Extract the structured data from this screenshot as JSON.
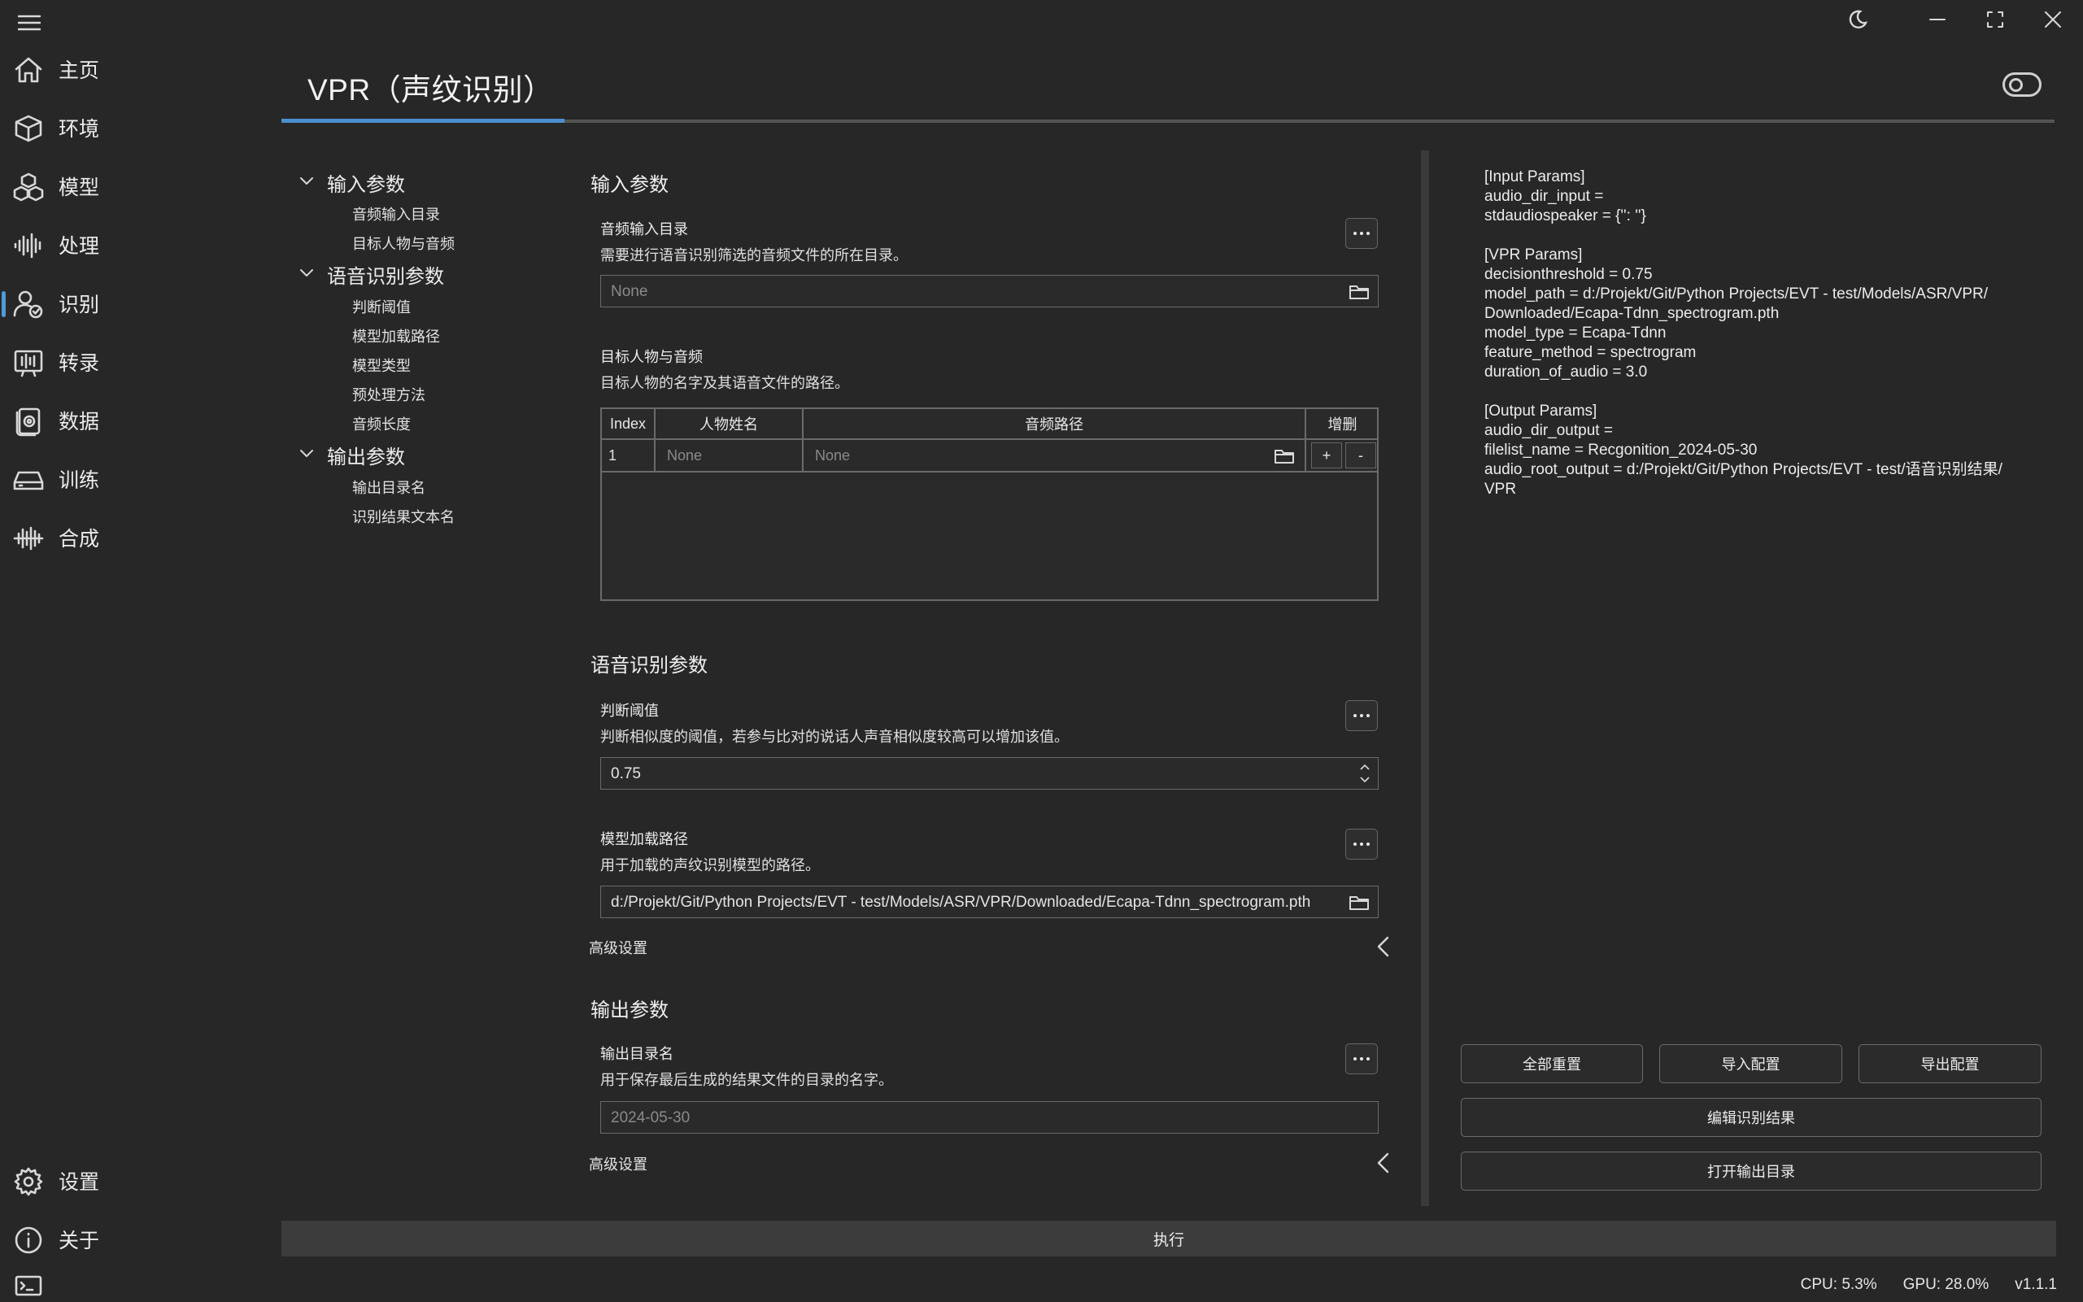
{
  "nav": {
    "items": [
      {
        "label": "主页",
        "icon": "home-icon"
      },
      {
        "label": "环境",
        "icon": "cube-icon"
      },
      {
        "label": "模型",
        "icon": "cubes-icon"
      },
      {
        "label": "处理",
        "icon": "waveform-icon"
      },
      {
        "label": "识别",
        "icon": "person-check-icon",
        "active": true
      },
      {
        "label": "转录",
        "icon": "transcribe-icon"
      },
      {
        "label": "数据",
        "icon": "database-icon"
      },
      {
        "label": "训练",
        "icon": "drive-icon"
      },
      {
        "label": "合成",
        "icon": "synth-icon"
      }
    ],
    "settings_label": "设置",
    "about_label": "关于"
  },
  "header": {
    "title": "VPR（声纹识别）"
  },
  "outline": {
    "groups": [
      {
        "label": "输入参数",
        "items": [
          "音频输入目录",
          "目标人物与音频"
        ]
      },
      {
        "label": "语音识别参数",
        "items": [
          "判断阈值",
          "模型加载路径",
          "模型类型",
          "预处理方法",
          "音频长度"
        ]
      },
      {
        "label": "输出参数",
        "items": [
          "输出目录名",
          "识别结果文本名"
        ]
      }
    ]
  },
  "form": {
    "input_section": {
      "title": "输入参数",
      "audio_dir": {
        "title": "音频输入目录",
        "desc": "需要进行语音识别筛选的音频文件的所在目录。",
        "placeholder": "None"
      },
      "speaker": {
        "title": "目标人物与音频",
        "desc": "目标人物的名字及其语音文件的路径。",
        "table": {
          "headers": [
            "Index",
            "人物姓名",
            "音频路径",
            "增删"
          ],
          "rows": [
            {
              "index": "1",
              "name": "None",
              "path": "None",
              "add": "+",
              "remove": "-"
            }
          ]
        }
      }
    },
    "vpr_section": {
      "title": "语音识别参数",
      "threshold": {
        "title": "判断阈值",
        "desc": "判断相似度的阈值，若参与比对的说话人声音相似度较高可以增加该值。",
        "value": "0.75"
      },
      "model_path": {
        "title": "模型加载路径",
        "desc": "用于加载的声纹识别模型的路径。",
        "value": "d:/Projekt/Git/Python Projects/EVT - test/Models/ASR/VPR/Downloaded/Ecapa-Tdnn_spectrogram.pth"
      },
      "advanced_label": "高级设置"
    },
    "output_section": {
      "title": "输出参数",
      "output_dir": {
        "title": "输出目录名",
        "desc": "用于保存最后生成的结果文件的目录的名字。",
        "placeholder": "2024-05-30"
      },
      "advanced_label": "高级设置"
    }
  },
  "config_view": {
    "lines": [
      "[Input Params]",
      "audio_dir_input =",
      "stdaudiospeaker = {'': ''}",
      "",
      "[VPR Params]",
      "decisionthreshold = 0.75",
      "model_path = d:/Projekt/Git/Python Projects/EVT - test/Models/ASR/VPR/",
      "Downloaded/Ecapa-Tdnn_spectrogram.pth",
      "model_type = Ecapa-Tdnn",
      "feature_method = spectrogram",
      "duration_of_audio = 3.0",
      "",
      "[Output Params]",
      "audio_dir_output =",
      "filelist_name = Recgonition_2024-05-30",
      "audio_root_output = d:/Projekt/Git/Python Projects/EVT - test/语音识别结果/",
      "VPR"
    ]
  },
  "actions": {
    "reset_all": "全部重置",
    "import_config": "导入配置",
    "export_config": "导出配置",
    "edit_result": "编辑识别结果",
    "open_output": "打开输出目录",
    "execute": "执行"
  },
  "status": {
    "cpu": "CPU: 5.3%",
    "gpu": "GPU: 28.0%",
    "version": "v1.1.1"
  },
  "colors": {
    "background": "#272727",
    "accent": "#4a8fcf"
  }
}
